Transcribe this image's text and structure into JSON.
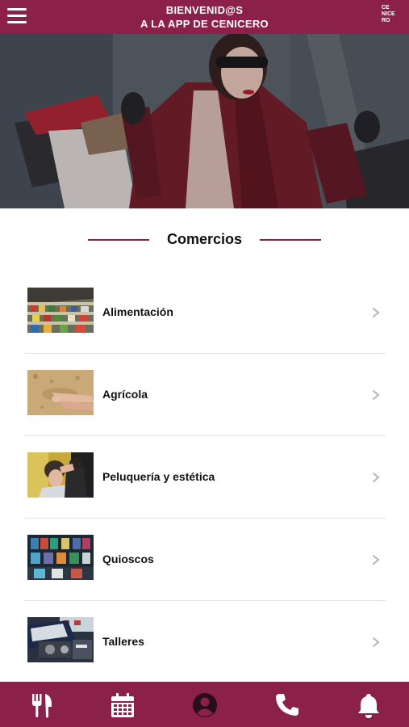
{
  "header": {
    "title_line1": "BIENVENID@S",
    "title_line2": "A LA APP DE CENICERO",
    "logo_text": [
      "CE",
      "NICE",
      "RO"
    ]
  },
  "section": {
    "title": "Comercios"
  },
  "categories": [
    {
      "label": "Alimentación",
      "thumb": "supermarket-shelves"
    },
    {
      "label": "Agrícola",
      "thumb": "hands-in-soil"
    },
    {
      "label": "Peluquería y estética",
      "thumb": "hairdresser"
    },
    {
      "label": "Quioscos",
      "thumb": "newsstand"
    },
    {
      "label": "Talleres",
      "thumb": "car-engine"
    }
  ],
  "bottom_nav": [
    {
      "name": "restaurant-icon"
    },
    {
      "name": "calendar-icon"
    },
    {
      "name": "user-icon"
    },
    {
      "name": "phone-icon"
    },
    {
      "name": "bell-icon"
    }
  ],
  "colors": {
    "brand": "#8b2148",
    "divider": "#e3e3e3",
    "chevron": "#b5b5b5"
  }
}
